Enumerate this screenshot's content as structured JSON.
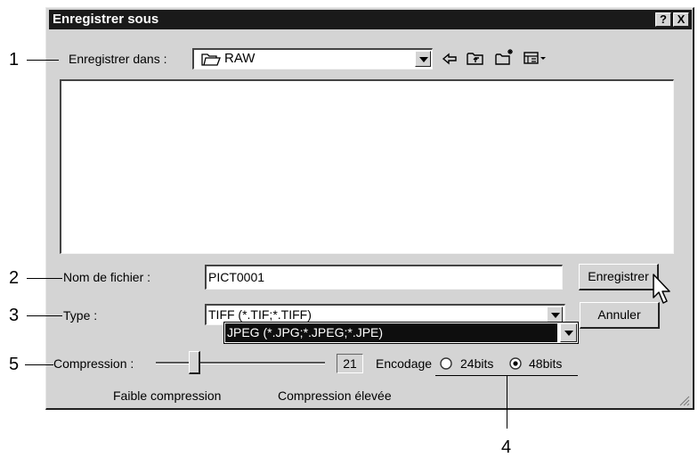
{
  "dialog": {
    "title": "Enregistrer sous",
    "help_button": "?",
    "close_button": "X"
  },
  "save_in": {
    "label": "Enregistrer dans :",
    "folder": "RAW",
    "toolbar_icons": [
      "back-arrow-icon",
      "up-folder-icon",
      "new-folder-icon",
      "view-menu-icon"
    ]
  },
  "file_name": {
    "label": "Nom de fichier :",
    "value": "PICT0001"
  },
  "file_type": {
    "label": "Type :",
    "value": "TIFF (*.TIF;*.TIFF)",
    "dropdown_selected": "JPEG (*.JPG;*.JPEG;*.JPE)"
  },
  "buttons": {
    "save": "Enregistrer",
    "cancel": "Annuler"
  },
  "compression": {
    "label": "Compression :",
    "value": "21",
    "slider_level": 0.21,
    "low_label": "Faible compression",
    "high_label": "Compression élevée"
  },
  "encoding": {
    "label": "Encodage",
    "options": [
      "24bits",
      "48bits"
    ],
    "selected": "48bits"
  },
  "callouts": {
    "c1": "1",
    "c2": "2",
    "c3": "3",
    "c4": "4",
    "c5": "5"
  }
}
